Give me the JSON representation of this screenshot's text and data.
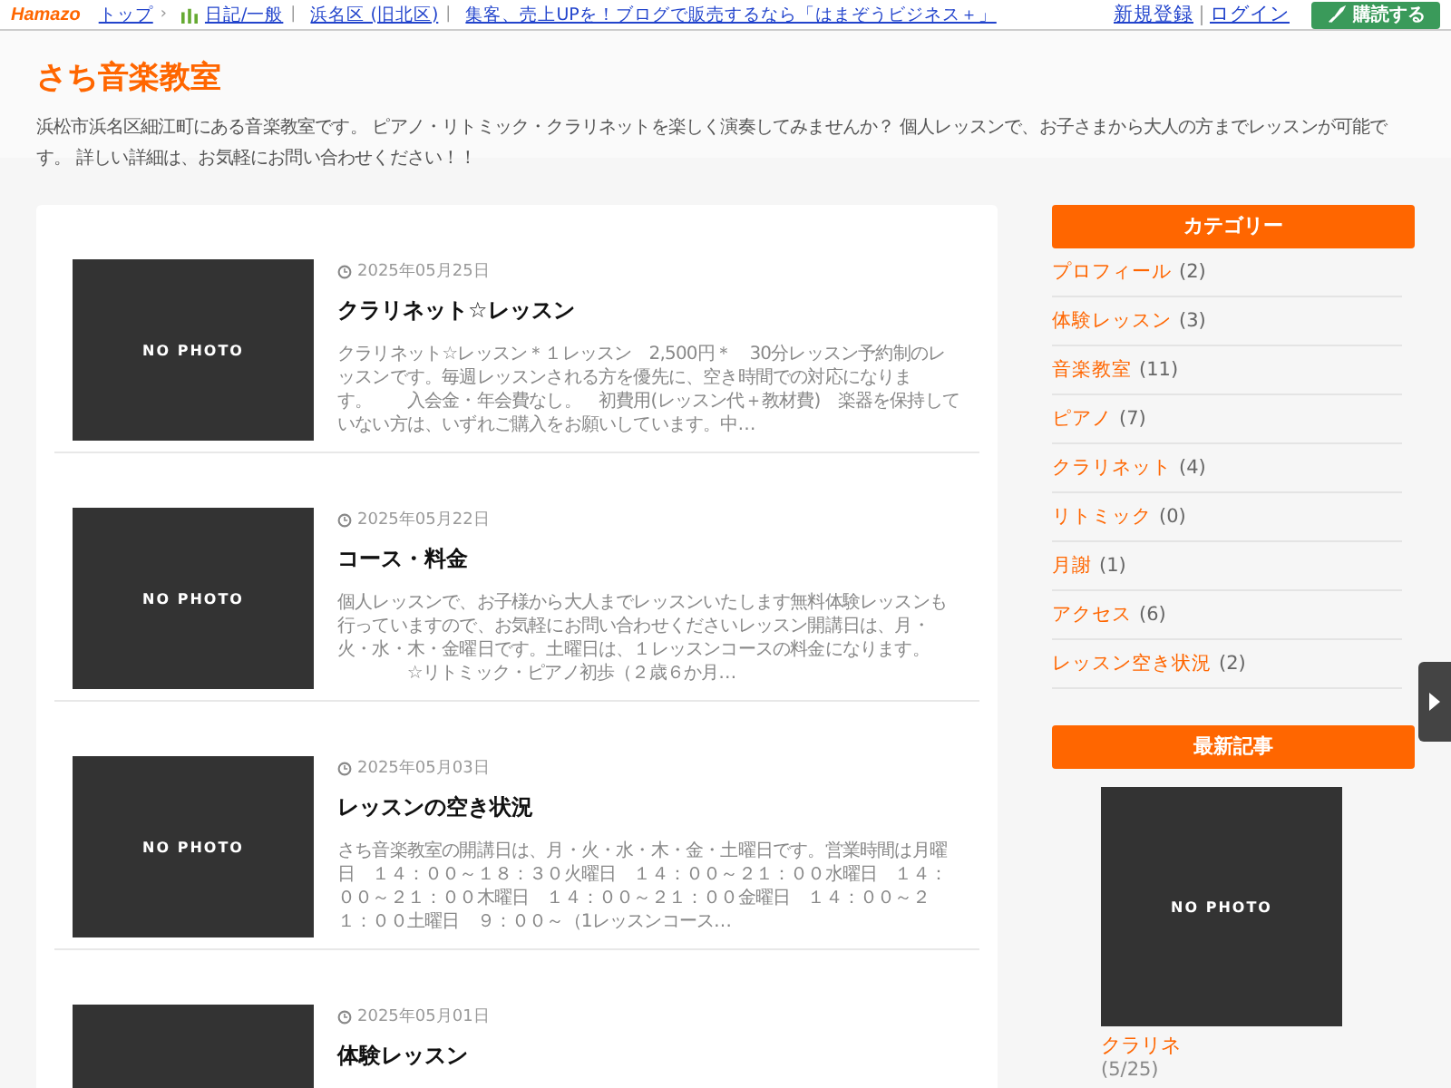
{
  "topbar": {
    "logo": "Hamazo",
    "links": [
      {
        "label": "トップ",
        "sep": "›"
      },
      {
        "label": "日記/一般",
        "sep": "|"
      },
      {
        "label": "浜名区 (旧北区)",
        "sep": "|"
      },
      {
        "label": "集客、売上UPを！ブログで販売するなら「はまぞうビジネス＋」"
      }
    ],
    "right_links": [
      "新規登録",
      "ログイン"
    ],
    "subscribe": "購読する"
  },
  "blog": {
    "title": "さち音楽教室",
    "description": "浜松市浜名区細江町にある音楽教室です。 ピアノ・リトミック・クラリネットを楽しく演奏してみませんか？ 個人レッスンで、お子さまから大人の方までレッスンが可能です。 詳しい詳細は、お気軽にお問い合わせください！！"
  },
  "posts": [
    {
      "thumb": "NO PHOTO",
      "date": "2025年05月25日",
      "title": "クラリネット☆レッスン",
      "excerpt": "クラリネット☆レッスン＊１レッスン　2,500円＊　30分レッスン予約制のレッスンです。毎週レッスンされる方を優先に、空き時間での対応になります。　　入会金・年会費なし。　初費用(レッスン代＋教材費)　楽器を保持していない方は、いずれご購入をお願いしています。中…"
    },
    {
      "thumb": "NO PHOTO",
      "date": "2025年05月22日",
      "title": "コース・料金",
      "excerpt": "個人レッスンで、お子様から大人までレッスンいたします無料体験レッスンも行っていますので、お気軽にお問い合わせくださいレッスン開講日は、月・火・水・木・金曜日です。土曜日は、１レッスンコースの料金になります。　　　　　☆リトミック・ピアノ初歩（２歳６か月…"
    },
    {
      "thumb": "NO PHOTO",
      "date": "2025年05月03日",
      "title": "レッスンの空き状況",
      "excerpt": "さち音楽教室の開講日は、月・火・水・木・金・土曜日です。営業時間は月曜日　１４：００～１８：３０火曜日　１４：００～２１：００水曜日　１４：００～２１：００木曜日　１４：００～２１：００金曜日　１４：００～２１：００土曜日　９：００～（1レッスンコース…"
    },
    {
      "date": "2025年05月01日",
      "title": "体験レッスン"
    }
  ],
  "sidebar": {
    "category_heading": "カテゴリー",
    "categories": [
      {
        "name": "プロフィール",
        "count": "(2)"
      },
      {
        "name": "体験レッスン",
        "count": "(3)"
      },
      {
        "name": "音楽教室",
        "count": "(11)"
      },
      {
        "name": "ピアノ",
        "count": "(7)"
      },
      {
        "name": "クラリネット",
        "count": "(4)"
      },
      {
        "name": "リトミック",
        "count": "(0)"
      },
      {
        "name": "月謝",
        "count": "(1)"
      },
      {
        "name": "アクセス",
        "count": "(6)"
      },
      {
        "name": "レッスン空き状況",
        "count": "(2)"
      }
    ],
    "recent_heading": "最新記事",
    "recent": [
      {
        "thumb": "NO PHOTO",
        "title": "クラリネ",
        "date": "(5/25)"
      }
    ]
  }
}
